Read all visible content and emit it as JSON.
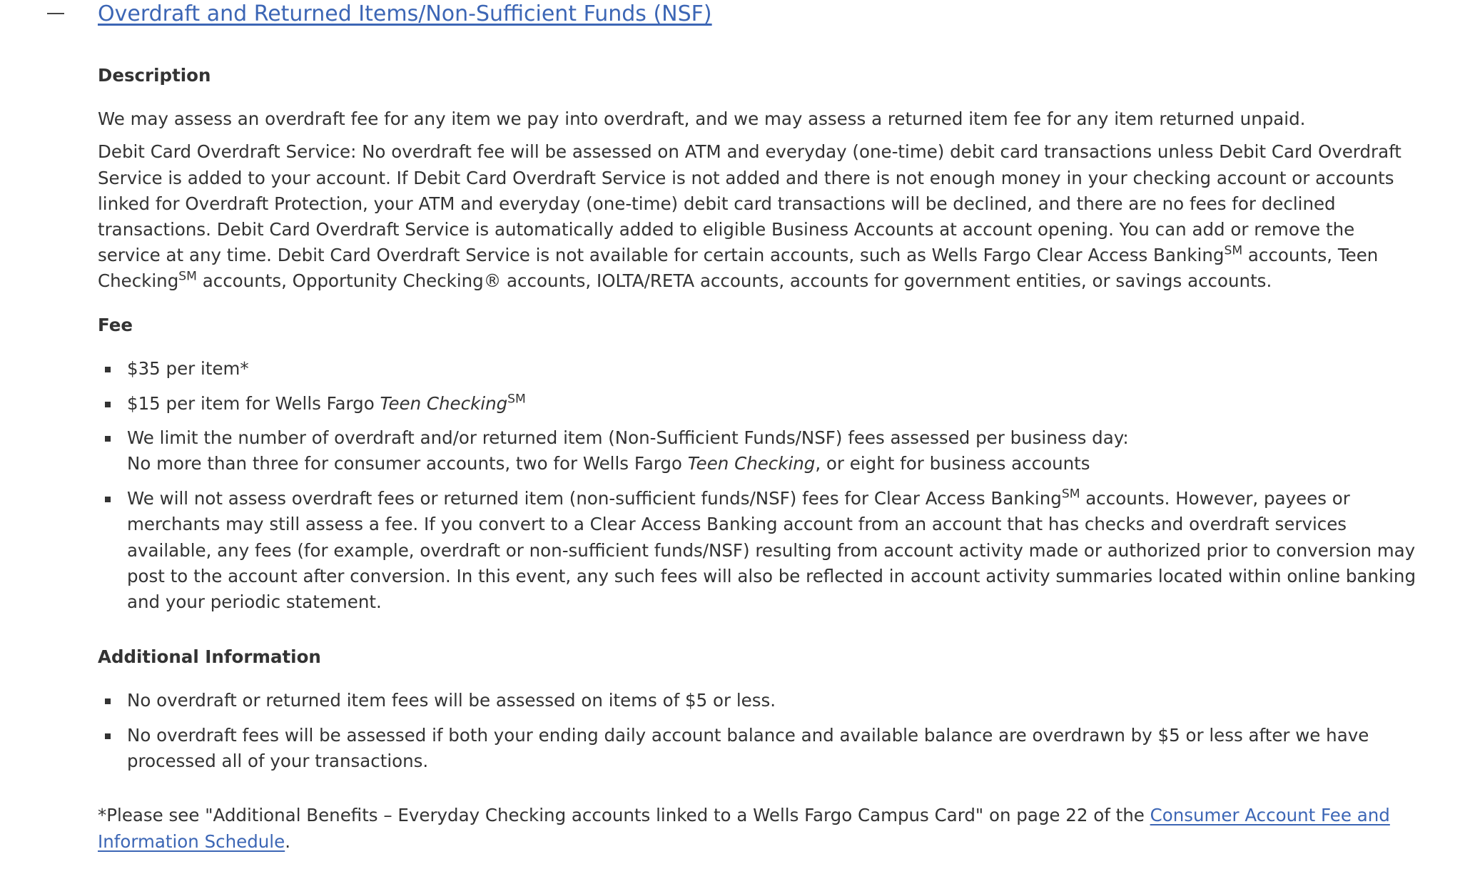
{
  "section": {
    "title": "Overdraft and Returned Items/Non-Sufficient Funds (NSF)",
    "toggle_icon": "minus-icon"
  },
  "description": {
    "heading": "Description",
    "para1": "We may assess an overdraft fee for any item we pay into overdraft, and we may assess a returned item fee for any item returned unpaid.",
    "para2_part1": "Debit Card Overdraft Service: No overdraft fee will be assessed on ATM and everyday (one-time) debit card transactions unless Debit Card Overdraft Service is added to your account. If Debit Card Overdraft Service is not added and there is not enough money in your checking account or accounts linked for Overdraft Protection, your ATM and everyday (one-time) debit card transactions will be declined, and there are no fees for declined transactions. Debit Card Overdraft Service is automatically added to eligible Business Accounts at account opening. You can add or remove the service at any time. Debit Card Overdraft Service is not available for certain accounts, such as Wells Fargo Clear Access Banking",
    "para2_sup1": "SM",
    "para2_part2": " accounts, Teen Checking",
    "para2_sup2": "SM",
    "para2_part3": " accounts, Opportunity Checking® accounts, IOLTA/RETA accounts, accounts for government entities, or savings accounts."
  },
  "fee": {
    "heading": "Fee",
    "item1": "$35 per item*",
    "item2_prefix": "$15 per item for Wells Fargo ",
    "item2_italic": "Teen Checking",
    "item2_sup": "SM",
    "item3_line1": "We limit the number of overdraft and/or returned item (Non-Sufficient Funds/NSF) fees assessed per business day:",
    "item3_line2_prefix": "No more than three for consumer accounts, two for Wells Fargo ",
    "item3_line2_italic": "Teen Checking",
    "item3_line2_suffix": ", or eight for business accounts",
    "item4_part1": "We will not assess overdraft fees or returned item (non-sufficient funds/NSF) fees for Clear Access Banking",
    "item4_sup": "SM",
    "item4_part2": " accounts. However, payees or merchants may still assess a fee. If you convert to a Clear Access Banking account from an account that has checks and overdraft services available, any fees (for example, overdraft or non-sufficient funds/NSF) resulting from account activity made or authorized prior to conversion may post to the account after conversion. In this event, any such fees will also be reflected in account activity summaries located within online banking and your periodic statement."
  },
  "additional": {
    "heading": "Additional Information",
    "item1": "No overdraft or returned item fees will be assessed on items of $5 or less.",
    "item2": "No overdraft fees will be assessed if both your ending daily account balance and available balance are overdrawn by $5 or less after we have processed all of your transactions."
  },
  "footnote": {
    "text": "*Please see \"Additional Benefits – Everyday Checking accounts linked to a Wells Fargo Campus Card\" on page 22 of the ",
    "link": "Consumer Account Fee and Information Schedule",
    "end": "."
  },
  "colors": {
    "link": "#3c66b5",
    "text": "#333333",
    "background": "#ffffff"
  }
}
